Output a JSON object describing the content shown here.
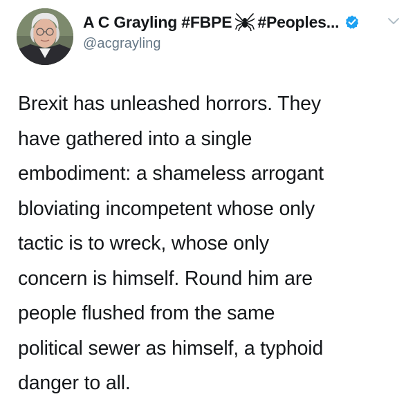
{
  "author": {
    "display_name": "A C Grayling #FBPE",
    "display_name_tail": "#Peoples...",
    "handle": "@acgrayling",
    "verified": true,
    "emoji_icon": "spider-icon",
    "avatar_description_icon": "avatar"
  },
  "tweet": {
    "lines": [
      "Brexit has unleashed horrors. They",
      "have gathered into a single",
      "embodiment: a shameless arrogant",
      "bloviating incompetent whose only",
      "tactic is to wreck, whose only",
      "concern is himself. Round him are",
      "people flushed from the same",
      "political sewer as himself, a typhoid",
      "danger to all."
    ]
  },
  "colors": {
    "text": "#14171a",
    "secondary_text": "#657786",
    "verified_blue": "#1da1f2",
    "chevron": "#aab8c2"
  }
}
